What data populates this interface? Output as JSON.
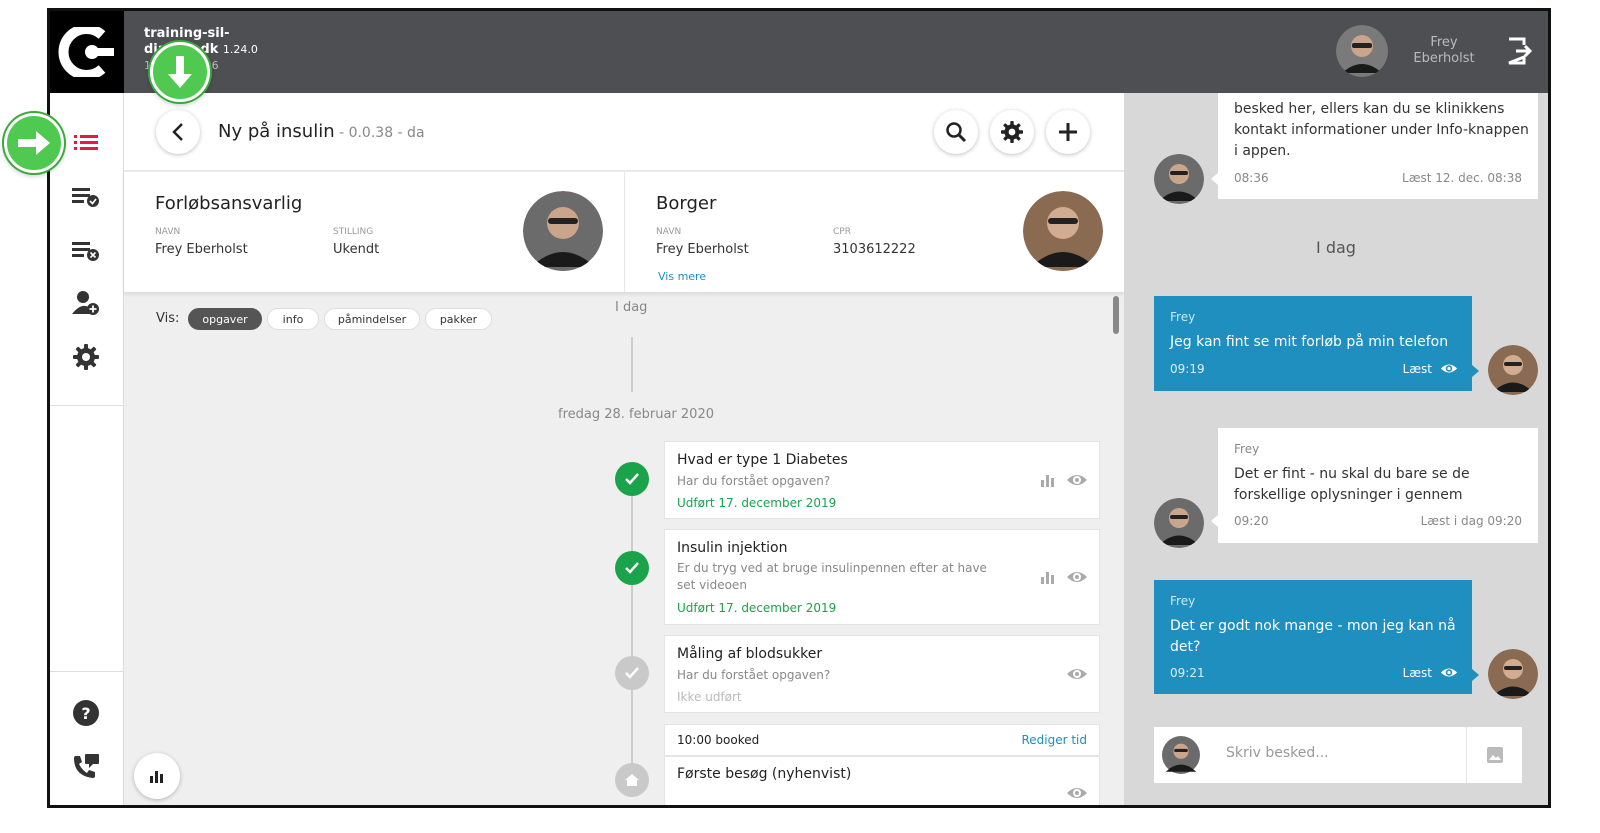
{
  "topbar": {
    "site_line1": "training-sil-",
    "site_line2": "dia   nto.dk",
    "version": "1.24.0",
    "sync_time": "1     er 09:49:06",
    "user_first": "Frey",
    "user_last": "Eberholst"
  },
  "header": {
    "title": "Ny på insulin",
    "subtitle": " - 0.0.38 - da"
  },
  "responsible": {
    "heading": "Forløbsansvarlig",
    "name_label": "NAVN",
    "name": "Frey Eberholst",
    "role_label": "STILLING",
    "role": "Ukendt"
  },
  "citizen": {
    "heading": "Borger",
    "name_label": "NAVN",
    "name": "Frey Eberholst",
    "cpr_label": "CPR",
    "cpr": "3103612222",
    "more_link": "Vis mere"
  },
  "filters": {
    "label": "Vis:",
    "chips": [
      "opgaver",
      "info",
      "påmindelser",
      "pakker"
    ],
    "active": "opgaver"
  },
  "timeline": {
    "today_label": "I dag",
    "date_label": "fredag 28. februar 2020",
    "tasks": [
      {
        "title": "Hvad er type 1 Diabetes",
        "question": "Har du forstået opgaven?",
        "status": "Udført 17. december 2019"
      },
      {
        "title": "Insulin injektion",
        "question": "Er du tryg ved at bruge insulinpennen efter at have set videoen",
        "status": "Udført 17. december 2019"
      },
      {
        "title": "Måling af blodsukker",
        "question": "Har du forstået opgaven?",
        "status": "Ikke udført"
      }
    ],
    "booking": {
      "time": "10:00 booked",
      "edit": "Rediger tid",
      "title": "Første besøg (nyhenvist)"
    }
  },
  "chat": {
    "msg0": {
      "text": "besked her, ellers kan du se klinikkens kontakt informationer under Info-knappen i appen.",
      "time": "08:36",
      "read": "Læst  12. dec. 08:38"
    },
    "today": "I dag",
    "msg1": {
      "name": "Frey",
      "text": "Jeg kan fint se mit forløb på min telefon",
      "time": "09:19",
      "read": "Læst"
    },
    "msg2": {
      "name": "Frey",
      "text": "Det er fint - nu skal du bare se de forskellige oplysninger i gennem",
      "time": "09:20",
      "read": "Læst  i dag 09:20"
    },
    "msg3": {
      "name": "Frey",
      "text": "Det er godt nok mange - mon jeg kan nå det?",
      "time": "09:21",
      "read": "Læst"
    },
    "composer_placeholder": "Skriv besked..."
  },
  "colors": {
    "accent": "#e4194a",
    "chat_blue": "#1f8fbf",
    "done_green": "#1aa34a",
    "topbar": "#4d4f52"
  }
}
